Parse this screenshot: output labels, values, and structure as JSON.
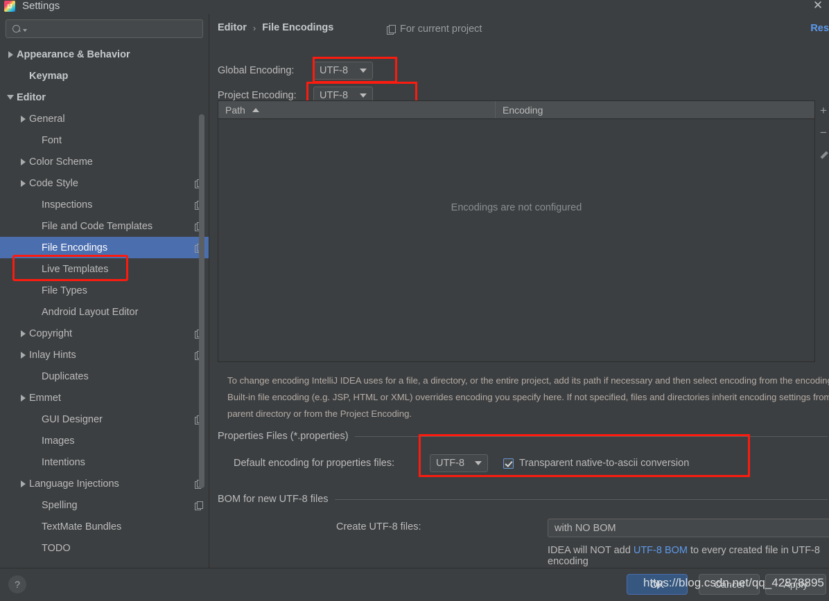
{
  "window": {
    "title": "Settings",
    "app_icon": "intellij-idea-icon",
    "close_icon": "close-icon"
  },
  "sidebar": {
    "search": {
      "value": "",
      "placeholder": "",
      "icon": "search-icon"
    },
    "items": [
      {
        "label": "Appearance & Behavior",
        "indent": 0,
        "twisty": "right",
        "bold": true,
        "badge": false,
        "selected": false
      },
      {
        "label": "Keymap",
        "indent": 1,
        "twisty": "none",
        "bold": true,
        "badge": false,
        "selected": false
      },
      {
        "label": "Editor",
        "indent": 0,
        "twisty": "down",
        "bold": true,
        "badge": false,
        "selected": false
      },
      {
        "label": "General",
        "indent": 1,
        "twisty": "right",
        "bold": false,
        "badge": false,
        "selected": false
      },
      {
        "label": "Font",
        "indent": 2,
        "twisty": "none",
        "bold": false,
        "badge": false,
        "selected": false
      },
      {
        "label": "Color Scheme",
        "indent": 1,
        "twisty": "right",
        "bold": false,
        "badge": false,
        "selected": false
      },
      {
        "label": "Code Style",
        "indent": 1,
        "twisty": "right",
        "bold": false,
        "badge": true,
        "selected": false
      },
      {
        "label": "Inspections",
        "indent": 2,
        "twisty": "none",
        "bold": false,
        "badge": true,
        "selected": false
      },
      {
        "label": "File and Code Templates",
        "indent": 2,
        "twisty": "none",
        "bold": false,
        "badge": true,
        "selected": false
      },
      {
        "label": "File Encodings",
        "indent": 2,
        "twisty": "none",
        "bold": false,
        "badge": true,
        "selected": true
      },
      {
        "label": "Live Templates",
        "indent": 2,
        "twisty": "none",
        "bold": false,
        "badge": false,
        "selected": false
      },
      {
        "label": "File Types",
        "indent": 2,
        "twisty": "none",
        "bold": false,
        "badge": false,
        "selected": false
      },
      {
        "label": "Android Layout Editor",
        "indent": 2,
        "twisty": "none",
        "bold": false,
        "badge": false,
        "selected": false
      },
      {
        "label": "Copyright",
        "indent": 1,
        "twisty": "right",
        "bold": false,
        "badge": true,
        "selected": false
      },
      {
        "label": "Inlay Hints",
        "indent": 1,
        "twisty": "right",
        "bold": false,
        "badge": true,
        "selected": false
      },
      {
        "label": "Duplicates",
        "indent": 2,
        "twisty": "none",
        "bold": false,
        "badge": false,
        "selected": false
      },
      {
        "label": "Emmet",
        "indent": 1,
        "twisty": "right",
        "bold": false,
        "badge": false,
        "selected": false
      },
      {
        "label": "GUI Designer",
        "indent": 2,
        "twisty": "none",
        "bold": false,
        "badge": true,
        "selected": false
      },
      {
        "label": "Images",
        "indent": 2,
        "twisty": "none",
        "bold": false,
        "badge": false,
        "selected": false
      },
      {
        "label": "Intentions",
        "indent": 2,
        "twisty": "none",
        "bold": false,
        "badge": false,
        "selected": false
      },
      {
        "label": "Language Injections",
        "indent": 1,
        "twisty": "right",
        "bold": false,
        "badge": true,
        "selected": false
      },
      {
        "label": "Spelling",
        "indent": 2,
        "twisty": "none",
        "bold": false,
        "badge": true,
        "selected": false
      },
      {
        "label": "TextMate Bundles",
        "indent": 2,
        "twisty": "none",
        "bold": false,
        "badge": false,
        "selected": false
      },
      {
        "label": "TODO",
        "indent": 2,
        "twisty": "none",
        "bold": false,
        "badge": false,
        "selected": false
      }
    ]
  },
  "main": {
    "breadcrumb": {
      "parent": "Editor",
      "separator": "›",
      "current": "File Encodings"
    },
    "scope_note": {
      "label": "For current project",
      "icon": "project-scope-icon"
    },
    "reset_link": "Rese",
    "global_encoding": {
      "label": "Global Encoding:",
      "value": "UTF-8"
    },
    "project_encoding": {
      "label": "Project Encoding:",
      "value": "UTF-8"
    },
    "table": {
      "columns": [
        "Path",
        "Encoding"
      ],
      "sort_column": "Path",
      "sort_direction": "asc",
      "rows": [],
      "empty_message": "Encodings are not configured",
      "toolbar": [
        {
          "icon": "plus-icon",
          "label": "+"
        },
        {
          "icon": "minus-icon",
          "label": "−"
        },
        {
          "icon": "pencil-icon",
          "label": ""
        }
      ]
    },
    "description": "To change encoding IntelliJ IDEA uses for a file, a directory, or the entire project, add its path if necessary and then select encoding from the encoding list. Built-in file encoding (e.g. JSP, HTML or XML) overrides encoding you specify here. If not specified, files and directories inherit encoding settings from the parent directory or from the Project Encoding.",
    "properties_group": {
      "title": "Properties Files (*.properties)",
      "default_encoding_label": "Default encoding for properties files:",
      "default_encoding_value": "UTF-8",
      "transparent_checkbox_label": "Transparent native-to-ascii conversion",
      "transparent_checked": true
    },
    "bom_group": {
      "title": "BOM for new UTF-8 files",
      "create_label": "Create UTF-8 files:",
      "create_value": "with NO BOM",
      "note_prefix": "IDEA will NOT add ",
      "note_link": "UTF-8 BOM",
      "note_suffix": " to every created file in UTF-8 encoding"
    }
  },
  "footer": {
    "help_icon": "help-icon",
    "help_label": "?",
    "ok_label": "OK",
    "cancel_label": "Cancel",
    "apply_label": "Apply"
  },
  "watermark": "https://blog.csdn.net/qq_42878895",
  "colors": {
    "background": "#3c3f41",
    "selection": "#4b6eaf",
    "link": "#5c9aee",
    "annotation_red": "#fc1b0f",
    "ok_button": "#365880"
  }
}
